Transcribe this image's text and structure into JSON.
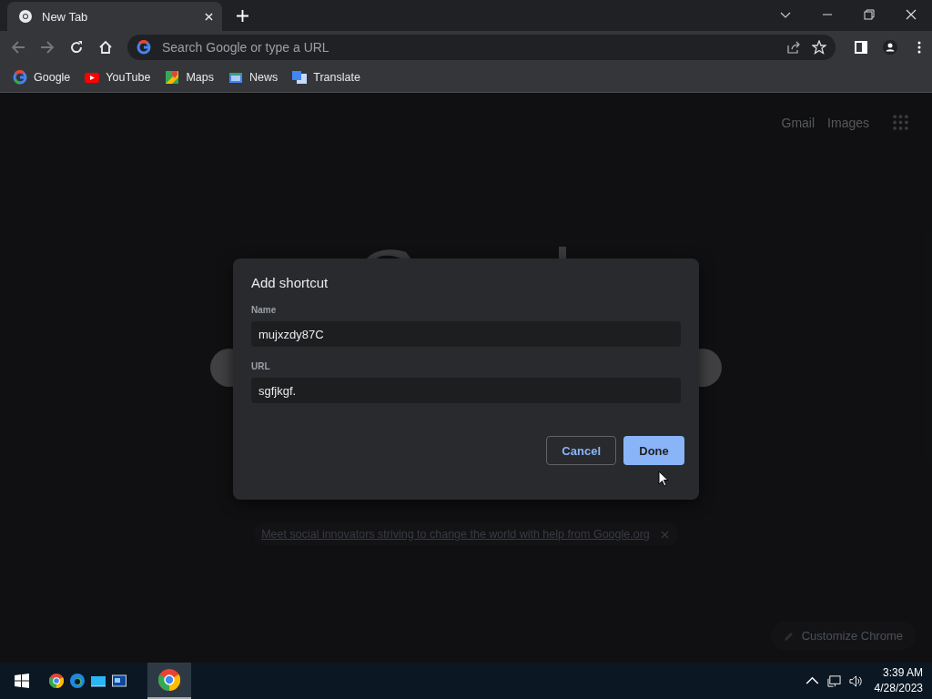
{
  "browser": {
    "tabs": [
      {
        "title": "New Tab",
        "selected": true
      }
    ],
    "omnibox": {
      "placeholder": "Search Google or type a URL"
    },
    "bookmarks": [
      {
        "label": "Google",
        "kind": "google"
      },
      {
        "label": "YouTube",
        "kind": "youtube"
      },
      {
        "label": "Maps",
        "kind": "maps"
      },
      {
        "label": "News",
        "kind": "news"
      },
      {
        "label": "Translate",
        "kind": "translate"
      }
    ]
  },
  "page": {
    "links": [
      "Gmail",
      "Images"
    ],
    "promo": "Meet social innovators striving to change the world with help from Google.org",
    "customize": "Customize Chrome"
  },
  "dialog": {
    "title": "Add shortcut",
    "fields": [
      {
        "label": "Name",
        "value": "mujxzdy87C"
      },
      {
        "label": "URL",
        "value": "sgfjkgf."
      }
    ],
    "buttons": [
      {
        "label": "Cancel",
        "kind": "secondary"
      },
      {
        "label": "Done",
        "kind": "primary"
      }
    ]
  },
  "taskbar": {
    "pinned": [
      {
        "kind": "chrome",
        "selected": false
      },
      {
        "kind": "edge",
        "selected": false
      },
      {
        "kind": "monitor",
        "selected": false
      },
      {
        "kind": "window",
        "selected": false
      },
      {
        "kind": "chrome",
        "selected": true
      }
    ],
    "time": "3:39 AM",
    "date": "4/28/2023"
  }
}
